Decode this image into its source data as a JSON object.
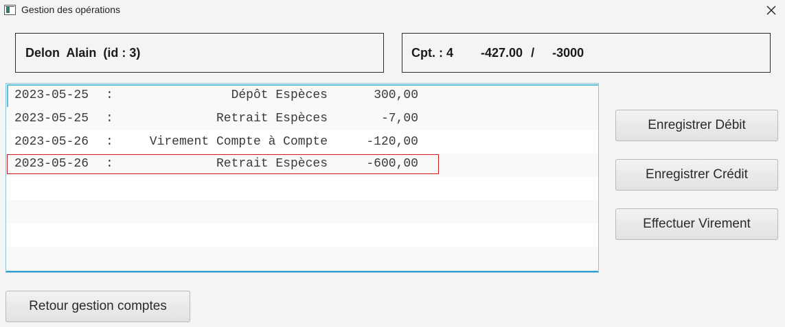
{
  "window": {
    "title": "Gestion des opérations",
    "close_symbol": "✕"
  },
  "client": {
    "text": "Delon  Alain  (id : 3)"
  },
  "account": {
    "number_text": "Cpt. : 4",
    "balance": "-427.00",
    "separator": "/",
    "overdraft": "-3000"
  },
  "operations": [
    {
      "date": "2023-05-25",
      "colon": ":",
      "label": "Dépôt Espèces",
      "amount": "300,00"
    },
    {
      "date": "2023-05-25",
      "colon": ":",
      "label": "Retrait Espèces",
      "amount": "-7,00"
    },
    {
      "date": "2023-05-26",
      "colon": ":",
      "label": "Virement Compte à Compte",
      "amount": "-120,00"
    },
    {
      "date": "2023-05-26",
      "colon": ":",
      "label": "Retrait Espèces",
      "amount": "-600,00"
    }
  ],
  "buttons": {
    "debit": "Enregistrer Débit",
    "credit": "Enregistrer Crédit",
    "virement": "Effectuer Virement",
    "retour": "Retour gestion comptes"
  },
  "colors": {
    "focus_border": "#5bbfdc",
    "hover_border": "#d11a1a",
    "list_bottom_accent": "#2b9fd1"
  },
  "icons": {
    "app": "window-app-icon",
    "close": "close-icon"
  }
}
